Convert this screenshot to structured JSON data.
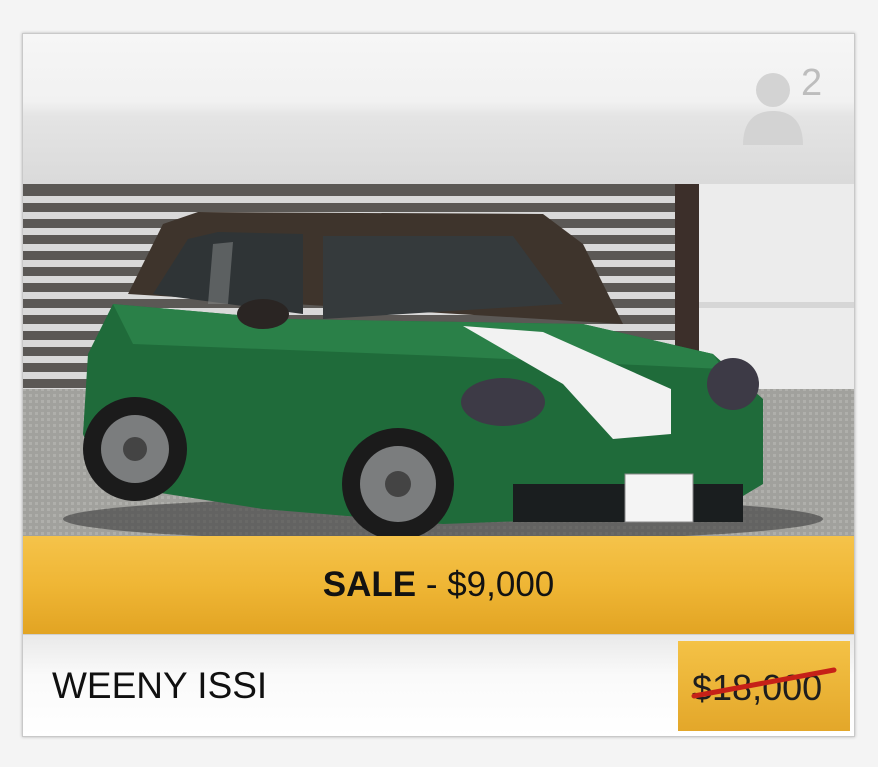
{
  "header": {
    "player_icon": "person-icon",
    "player_count": "2"
  },
  "vehicle": {
    "photo": "green-hatchback-car-photo",
    "sale_label": "SALE",
    "sale_separator": " - ",
    "sale_price": "$9,000",
    "name": "WEENY ISSI",
    "original_price": "$18,000"
  },
  "colors": {
    "banner": "#efb635",
    "strike": "#c62118",
    "car_body": "#1f6b3a"
  }
}
